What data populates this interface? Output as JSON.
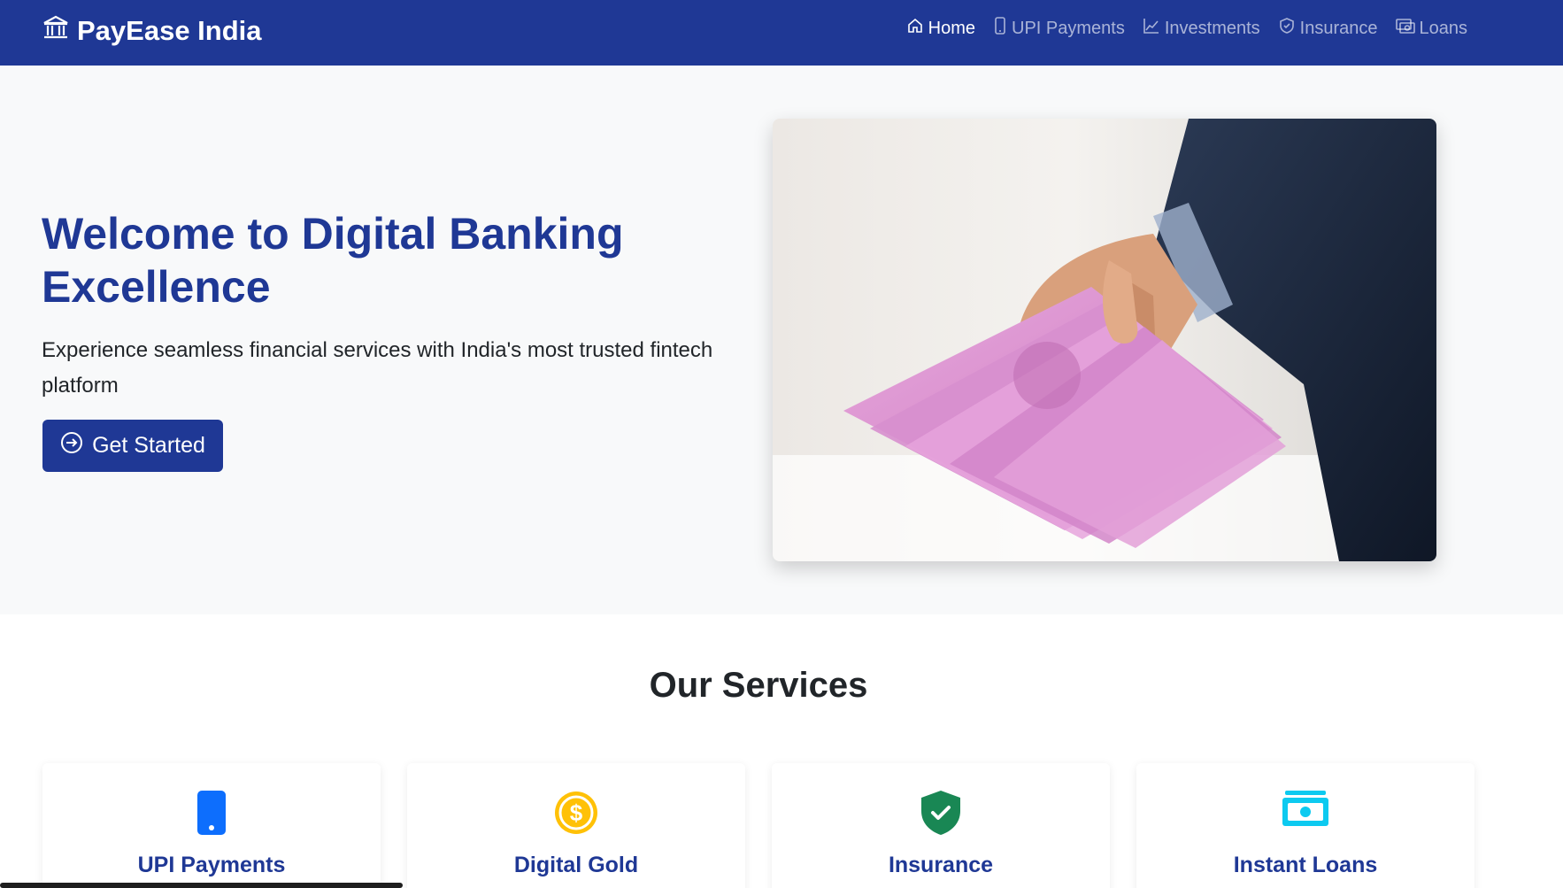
{
  "brand": {
    "name": "PayEase India",
    "icon": "bank-icon"
  },
  "nav": {
    "items": [
      {
        "label": "Home",
        "icon": "home-icon",
        "active": true
      },
      {
        "label": "UPI Payments",
        "icon": "phone-icon",
        "active": false
      },
      {
        "label": "Investments",
        "icon": "chart-icon",
        "active": false
      },
      {
        "label": "Insurance",
        "icon": "shield-icon",
        "active": false
      },
      {
        "label": "Loans",
        "icon": "cash-icon",
        "active": false
      }
    ]
  },
  "hero": {
    "title": "Welcome to Digital Banking Excellence",
    "subtitle": "Experience seamless financial services with India's most trusted fintech platform",
    "cta_label": "Get Started",
    "cta_icon": "arrow-circle-right-icon"
  },
  "services": {
    "heading": "Our Services",
    "cards": [
      {
        "label": "UPI Payments",
        "icon": "phone-icon",
        "color": "#0d6efd"
      },
      {
        "label": "Digital Gold",
        "icon": "coin-icon",
        "color": "#ffc107"
      },
      {
        "label": "Insurance",
        "icon": "shield-check-icon",
        "color": "#198754"
      },
      {
        "label": "Instant Loans",
        "icon": "cash-icon",
        "color": "#0dcaf0"
      }
    ]
  },
  "colors": {
    "primary": "#1f3895",
    "hero_bg": "#f8f9fa"
  }
}
